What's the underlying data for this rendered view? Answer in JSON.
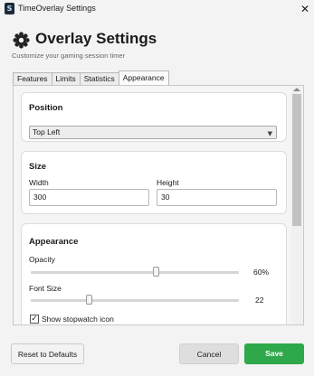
{
  "window": {
    "title": "TimeOverlay Settings",
    "close_glyph": "✕"
  },
  "header": {
    "title": "Overlay Settings",
    "subtitle": "Customize your gaming session timer"
  },
  "tabs": [
    {
      "label": "Features",
      "active": false
    },
    {
      "label": "Limits",
      "active": false
    },
    {
      "label": "Statistics",
      "active": false
    },
    {
      "label": "Appearance",
      "active": true
    }
  ],
  "position_card": {
    "title": "Position",
    "selected": "Top Left"
  },
  "size_card": {
    "title": "Size",
    "width_label": "Width",
    "width_value": "300",
    "height_label": "Height",
    "height_value": "30"
  },
  "appearance_card": {
    "title": "Appearance",
    "opacity_label": "Opacity",
    "opacity_value": "60%",
    "opacity_fraction": 0.6,
    "font_size_label": "Font Size",
    "font_size_value": "22",
    "font_size_fraction": 0.28,
    "stopwatch_label": "Show stopwatch icon",
    "stopwatch_checked": true
  },
  "footer": {
    "reset_label": "Reset to Defaults",
    "cancel_label": "Cancel",
    "save_label": "Save"
  },
  "colors": {
    "save_button": "#2ea84a",
    "app_icon": "#1e2a38"
  },
  "icons": {
    "app": "app-icon",
    "header": "gear-icon",
    "close": "close-icon",
    "dropdown": "chevron-down-icon",
    "check": "checkmark-icon"
  }
}
